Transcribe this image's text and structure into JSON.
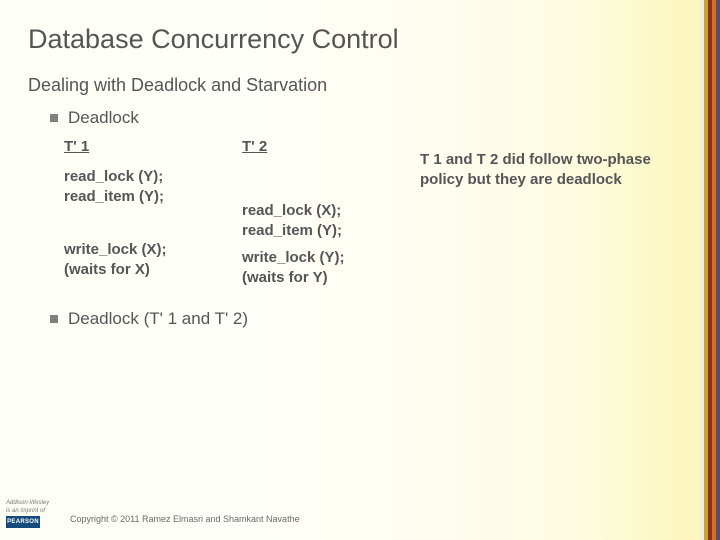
{
  "title": "Database Concurrency Control",
  "subtitle": "Dealing with Deadlock and Starvation",
  "bullet1": "Deadlock",
  "bullet2": "Deadlock (T' 1 and T' 2)",
  "col1": {
    "header": "T' 1",
    "block1": "read_lock (Y);\nread_item (Y);",
    "block2": "write_lock (X);\n(waits for X)"
  },
  "col2": {
    "header": "T' 2",
    "block1": "read_lock (X);\nread_item (Y);",
    "block2": "write_lock (Y);\n(waits for Y)"
  },
  "comment": "T 1 and T 2 did follow two-phase policy but they are deadlock",
  "copyright": "Copyright © 2011 Ramez Elmasri and Shamkant Navathe",
  "logo": {
    "aw": "Addison-Wesley",
    "imprint": "is an imprint of",
    "pearson": "PEARSON"
  }
}
